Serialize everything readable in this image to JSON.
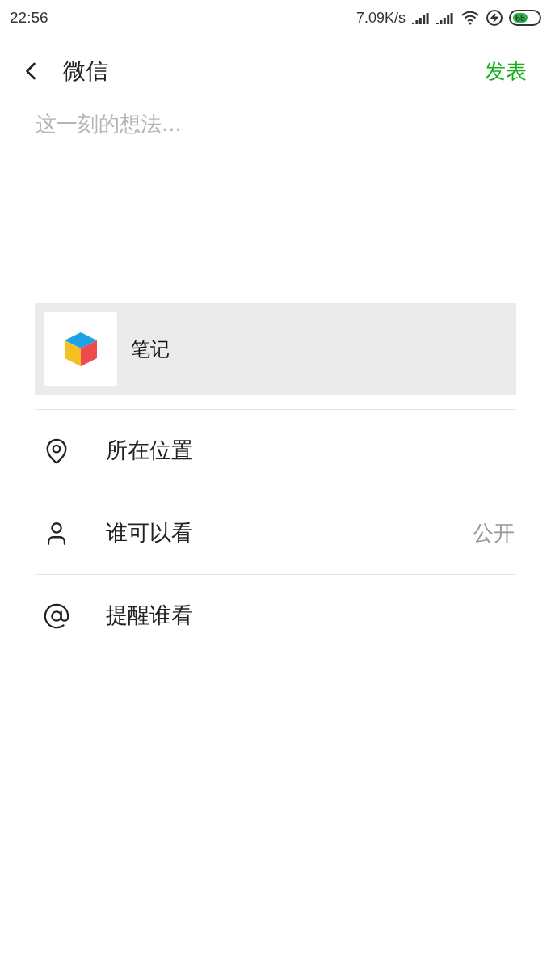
{
  "status_bar": {
    "time": "22:56",
    "speed": "7.09K/s",
    "battery": "65"
  },
  "header": {
    "back_label": "微信",
    "action": "发表"
  },
  "composer": {
    "placeholder": "这一刻的想法..."
  },
  "attachment": {
    "title": "笔记"
  },
  "options": [
    {
      "kind": "location",
      "label": "所在位置"
    },
    {
      "kind": "visibility",
      "label": "谁可以看",
      "value": "公开"
    },
    {
      "kind": "mention",
      "label": "提醒谁看"
    }
  ]
}
